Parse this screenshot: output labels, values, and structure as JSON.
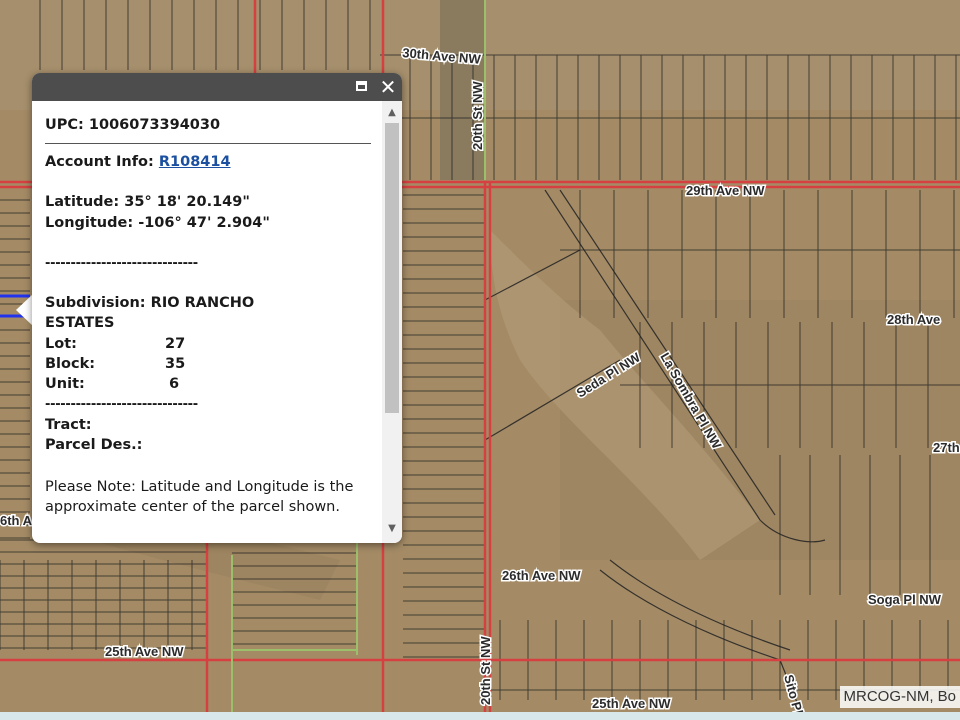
{
  "map": {
    "roads": {
      "ave_30th": "30th Ave NW",
      "ave_29th": "29th Ave NW",
      "ave_28th": "28th Ave",
      "ave_27th": "27th",
      "ave_26th": "26th Ave NW",
      "ave_25th_left": "25th Ave NW",
      "ave_25th_right": "25th Ave NW",
      "st_20th_top": "20th St NW",
      "st_20th_bottom": "20th St NW",
      "seda": "Seda Pl NW",
      "la_sombra": "La Sombra Pl NW",
      "soga": "Soga Pl NW",
      "sito": "Sito Pl",
      "ave_26th_left_partial": "6th A"
    },
    "attribution": "MRCOG-NM, Bo",
    "colors": {
      "boundary_red": "#d64040",
      "street_green": "#9bbf6a",
      "selection_blue": "#2233ee",
      "terrain": "#a48b66"
    }
  },
  "popup": {
    "upc_label": "UPC:",
    "upc_value": "1006073394030",
    "account_label": "Account Info:",
    "account_value": "R108414",
    "latitude_label": "Latitude:",
    "latitude_value": "35° 18' 20.149\"",
    "longitude_label": "Longitude:",
    "longitude_value": "-106° 47' 2.904\"",
    "separator": "------------------------------",
    "subdivision_label": "Subdivision:",
    "subdivision_value_1": "RIO RANCHO",
    "subdivision_value_2": "ESTATES",
    "lot_label": "Lot:",
    "lot_value": "27",
    "block_label": "Block:",
    "block_value": "35",
    "unit_label": "Unit:",
    "unit_value": "6",
    "tract_label": "Tract:",
    "parcel_des_label": "Parcel Des.:",
    "note": "Please Note: Latitude and Longitude is the approximate center of the parcel shown.",
    "close_glyph": "✕",
    "maximize_icon": "maximize-icon",
    "close_icon": "close-icon",
    "scroll_up_glyph": "▲",
    "scroll_down_glyph": "▼"
  }
}
